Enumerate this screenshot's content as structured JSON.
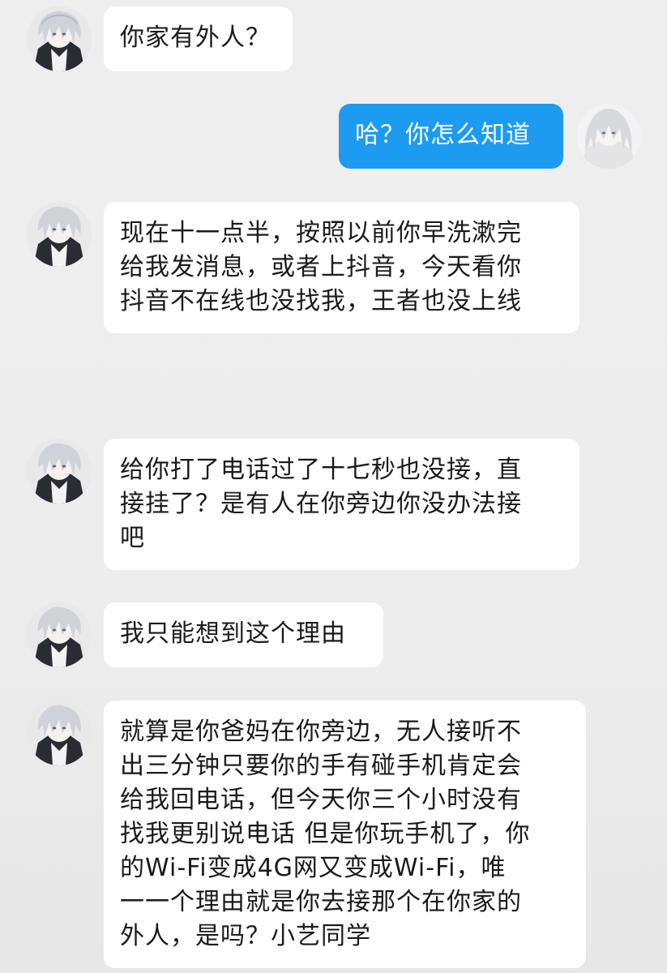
{
  "colors": {
    "background": "#eeeeee",
    "received_bubble": "#ffffff",
    "sent_bubble": "#1d9bf0",
    "received_text": "#1a1a1a",
    "sent_text": "#ffffff"
  },
  "messages": [
    {
      "sender": "contact",
      "avatar": "anime-avatar-icon",
      "lines": [
        "你家有外人？"
      ]
    },
    {
      "sender": "me",
      "avatar": "anime-avatar-icon",
      "lines": [
        "哈？你怎么知道"
      ]
    },
    {
      "sender": "contact",
      "avatar": "anime-avatar-icon",
      "lines": [
        "现在十一点半，按照以前你早洗漱完",
        "给我发消息，或者上抖音，今天看你",
        "抖音不在线也没找我，王者也没上线"
      ]
    },
    {
      "sender": "contact",
      "avatar": "anime-avatar-icon",
      "lines": [
        "给你打了电话过了十七秒也没接，直",
        "接挂了？是有人在你旁边你没办法接",
        "吧"
      ]
    },
    {
      "sender": "contact",
      "avatar": "anime-avatar-icon",
      "lines": [
        "我只能想到这个理由"
      ]
    },
    {
      "sender": "contact",
      "avatar": "anime-avatar-icon",
      "lines": [
        "就算是你爸妈在你旁边，无人接听不",
        "出三分钟只要你的手有碰手机肯定会",
        "给我回电话，但今天你三个小时没有",
        "找我更别说电话 但是你玩手机了，你",
        "的Wi-Fi变成4G网又变成Wi-Fi，唯",
        "一一个理由就是你去接那个在你家的",
        "外人，是吗？小艺同学"
      ]
    }
  ]
}
